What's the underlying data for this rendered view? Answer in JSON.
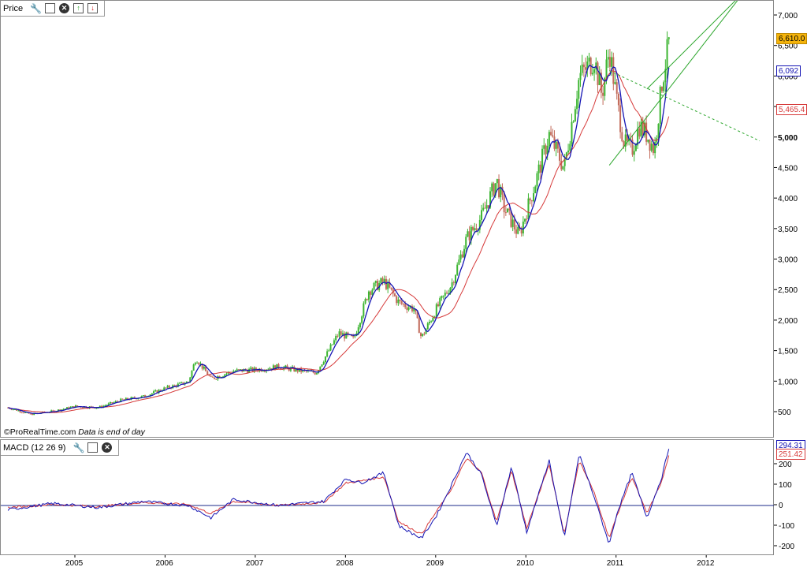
{
  "price_pane": {
    "title": "Price",
    "watermark": "©ProRealTime.com",
    "watermark_note": "Data is end of day",
    "icons": [
      "wrench-icon",
      "window-icon",
      "close-icon",
      "arrow-up-icon",
      "arrow-down-icon"
    ]
  },
  "macd_pane": {
    "title": "MACD (12 26 9)",
    "icons": [
      "wrench-icon",
      "window-icon",
      "close-icon"
    ]
  },
  "value_boxes": {
    "last_price": "6,610.0",
    "ma_fast": "6,092",
    "ma_slow": "5,465.4",
    "macd": "294.31",
    "signal": "251.42"
  },
  "colors": {
    "up_bar": "#3cb531",
    "down_bar": "#c26a5a",
    "ma_fast": "#1414b4",
    "ma_slow": "#d63a3a",
    "trendline": "#2aa52a",
    "last_price_box": "#f5b40c",
    "zero_line": "#1b2a8a"
  },
  "chart_data": [
    {
      "type": "candlestick",
      "title": "Price",
      "x": [
        "2004-04",
        "2004-07",
        "2004-10",
        "2005-01",
        "2005-04",
        "2005-07",
        "2005-10",
        "2006-01",
        "2006-04",
        "2006-05",
        "2006-07",
        "2006-10",
        "2007-01",
        "2007-04",
        "2007-07",
        "2007-09",
        "2007-12",
        "2008-02",
        "2008-04",
        "2008-06",
        "2008-08",
        "2008-10",
        "2008-11",
        "2009-01",
        "2009-03",
        "2009-05",
        "2009-07",
        "2009-09",
        "2009-10",
        "2009-12",
        "2010-02",
        "2010-04",
        "2010-06",
        "2010-08",
        "2010-10",
        "2010-11",
        "2010-12",
        "2011-01",
        "2011-02",
        "2011-03",
        "2011-04",
        "2011-05",
        "2011-06",
        "2011-07",
        "2011-08"
      ],
      "close": [
        580,
        470,
        520,
        600,
        580,
        700,
        760,
        900,
        1000,
        1390,
        1050,
        1180,
        1200,
        1250,
        1180,
        1150,
        1800,
        1700,
        2500,
        2650,
        2300,
        2200,
        1720,
        2200,
        2600,
        3350,
        3700,
        4300,
        3850,
        3400,
        4200,
        5050,
        4500,
        6000,
        6300,
        5700,
        6450,
        5600,
        4900,
        4800,
        5200,
        5050,
        4800,
        5900,
        6610
      ],
      "ma_fast": {
        "name": "",
        "last": 6092
      },
      "ma_slow": {
        "name": "",
        "last": 5465.4
      },
      "last_price": 6610.0,
      "ylim": [
        200,
        7200
      ],
      "yticks": [
        500,
        1000,
        1500,
        2000,
        2500,
        3000,
        3500,
        4000,
        4500,
        5000,
        5500,
        6000,
        6500,
        7000
      ],
      "ytick_labels": [
        "500",
        "1,000",
        "1,500",
        "2,000",
        "2,500",
        "3,000",
        "3,500",
        "4,000",
        "4,500",
        "5,000",
        "5,500",
        "6,000",
        "6,500",
        "7,000"
      ],
      "trendlines": [
        {
          "style": "solid",
          "from": [
            "2010-12",
            4550
          ],
          "to": [
            "2012-06",
            7400
          ]
        },
        {
          "style": "solid",
          "from": [
            "2011-05",
            5800
          ],
          "to": [
            "2012-06",
            7400
          ]
        },
        {
          "style": "dashed",
          "from": [
            "2010-12",
            6100
          ],
          "to": [
            "2012-08",
            4950
          ]
        }
      ]
    },
    {
      "type": "line",
      "title": "MACD (12 26 9)",
      "x": [
        "2004-04",
        "2004-10",
        "2005-04",
        "2005-10",
        "2006-04",
        "2006-07",
        "2006-10",
        "2007-04",
        "2007-10",
        "2008-01",
        "2008-03",
        "2008-06",
        "2008-08",
        "2008-11",
        "2009-01",
        "2009-03",
        "2009-05",
        "2009-07",
        "2009-09",
        "2009-11",
        "2010-01",
        "2010-04",
        "2010-06",
        "2010-08",
        "2010-10",
        "2010-12",
        "2011-01",
        "2011-03",
        "2011-05",
        "2011-07",
        "2011-08"
      ],
      "series": [
        {
          "name": "",
          "values": [
            -20,
            10,
            -10,
            20,
            0,
            -60,
            30,
            0,
            20,
            130,
            110,
            160,
            -100,
            -160,
            -50,
            100,
            260,
            150,
            -100,
            190,
            -130,
            220,
            -160,
            250,
            40,
            -190,
            -40,
            160,
            -60,
            140,
            294.31
          ]
        },
        {
          "name": "",
          "values": [
            -10,
            5,
            -5,
            15,
            5,
            -40,
            20,
            0,
            15,
            110,
            120,
            140,
            -80,
            -140,
            -30,
            80,
            230,
            160,
            -80,
            170,
            -110,
            200,
            -140,
            220,
            60,
            -160,
            -50,
            140,
            -40,
            120,
            251.42
          ]
        }
      ],
      "ylim": [
        -240,
        320
      ],
      "yticks": [
        -200,
        -100,
        0,
        100,
        200
      ],
      "ytick_labels": [
        "-200",
        "-100",
        "0",
        "100",
        "200"
      ]
    }
  ],
  "x_axis": {
    "labels": [
      "2005",
      "2006",
      "2007",
      "2008",
      "2009",
      "2010",
      "2011",
      "2012"
    ]
  }
}
